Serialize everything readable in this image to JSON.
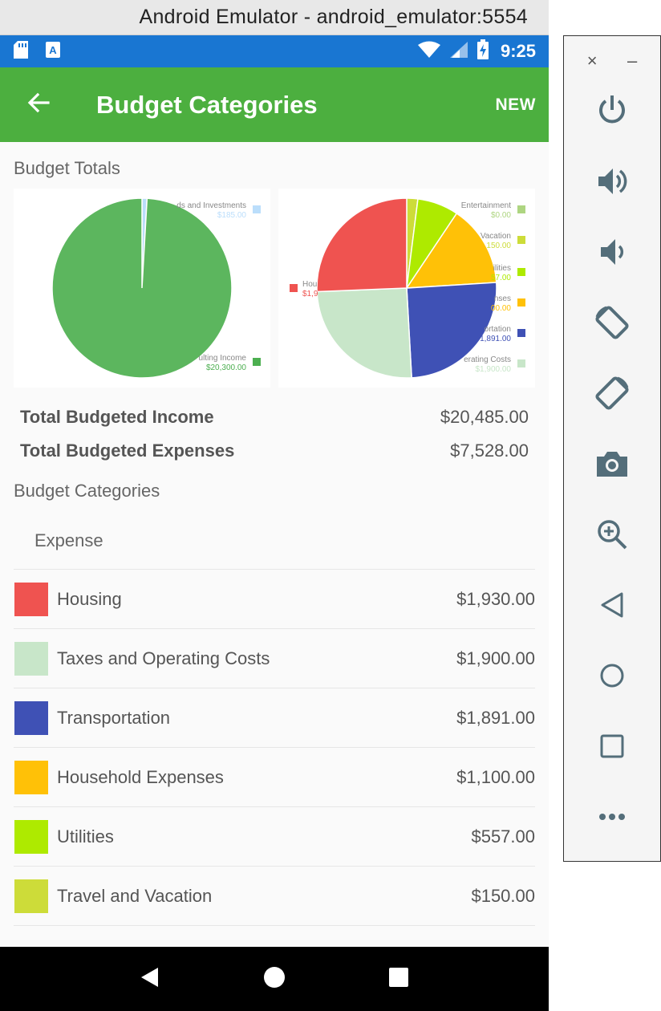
{
  "window": {
    "title": "Android Emulator - android_emulator:5554"
  },
  "status_bar": {
    "time": "9:25",
    "icons": [
      "sd-card-icon",
      "a-notification-icon",
      "wifi-icon",
      "signal-icon",
      "battery-charging-icon"
    ]
  },
  "app_bar": {
    "title": "Budget Categories",
    "new_label": "NEW",
    "back_icon": "arrow-back-icon"
  },
  "section_totals": "Budget Totals",
  "chart_data": [
    {
      "type": "pie",
      "series": [
        {
          "name": "Dividends and Investments",
          "value": 185.0,
          "label": "$185.00",
          "color": "#bbdefb"
        },
        {
          "name": "Consulting Income",
          "value": 20300.0,
          "label": "$20,300.00",
          "color": "#5cb65e"
        }
      ],
      "legend_visible": [
        {
          "text": "ds and Investments",
          "value": "$185.00",
          "color": "#bbdefb"
        },
        {
          "text": "ulting Income",
          "value": "$20,300.00",
          "color": "#4caf50"
        }
      ],
      "legend": "right"
    },
    {
      "type": "pie",
      "series": [
        {
          "name": "Housing",
          "value": 1930,
          "color": "#ef5350"
        },
        {
          "name": "Taxes and Operating Costs",
          "value": 1900,
          "color": "#c8e6c9"
        },
        {
          "name": "Transportation",
          "value": 1891,
          "color": "#3f51b5"
        },
        {
          "name": "Household Expenses",
          "value": 1100,
          "color": "#ffc107"
        },
        {
          "name": "Utilities",
          "value": 557,
          "color": "#aeea00"
        },
        {
          "name": "Travel and Vacation",
          "value": 150,
          "color": "#cddc39"
        },
        {
          "name": "Entertainment",
          "value": 0,
          "color": "#aed581"
        }
      ],
      "legend_visible": [
        {
          "text": "Entertainment",
          "value": "$0.00",
          "color": "#aed581"
        },
        {
          "text": "Vacation",
          "value": "150.00",
          "color": "#cddc39"
        },
        {
          "text": "ilities",
          "value": "57.00",
          "color": "#aeea00"
        },
        {
          "text": "nses",
          "value": "00.00",
          "color": "#ffc107"
        },
        {
          "text": "ortation",
          "value": "1,891.00",
          "color": "#3f51b5"
        },
        {
          "text": "erating Costs",
          "value": "$1,900.00",
          "color": "#c8e6c9"
        },
        {
          "text": "Hou",
          "value": "$1,9",
          "color": "#ef5350"
        }
      ],
      "legend": "right"
    }
  ],
  "totals": {
    "income_label": "Total Budgeted Income",
    "income_value": "$20,485.00",
    "expenses_label": "Total Budgeted Expenses",
    "expenses_value": "$7,528.00"
  },
  "section_categories": "Budget Categories",
  "group_header": "Expense",
  "categories": [
    {
      "name": "Housing",
      "amount": "$1,930.00",
      "color": "#ef5350"
    },
    {
      "name": "Taxes and Operating Costs",
      "amount": "$1,900.00",
      "color": "#c8e6c9"
    },
    {
      "name": "Transportation",
      "amount": "$1,891.00",
      "color": "#3f51b5"
    },
    {
      "name": "Household Expenses",
      "amount": "$1,100.00",
      "color": "#ffc107"
    },
    {
      "name": "Utilities",
      "amount": "$557.00",
      "color": "#aeea00"
    },
    {
      "name": "Travel and Vacation",
      "amount": "$150.00",
      "color": "#cddc39"
    }
  ],
  "nav_bar": {
    "icons": [
      "nav-back-icon",
      "nav-home-icon",
      "nav-recents-icon"
    ]
  },
  "side_toolbar": {
    "close_glyph": "×",
    "minimize_glyph": "–",
    "icons": [
      "power-icon",
      "volume-up-icon",
      "volume-down-icon",
      "rotate-left-icon",
      "rotate-right-icon",
      "camera-icon",
      "zoom-icon",
      "back-icon",
      "home-icon",
      "overview-icon",
      "more-icon"
    ]
  }
}
